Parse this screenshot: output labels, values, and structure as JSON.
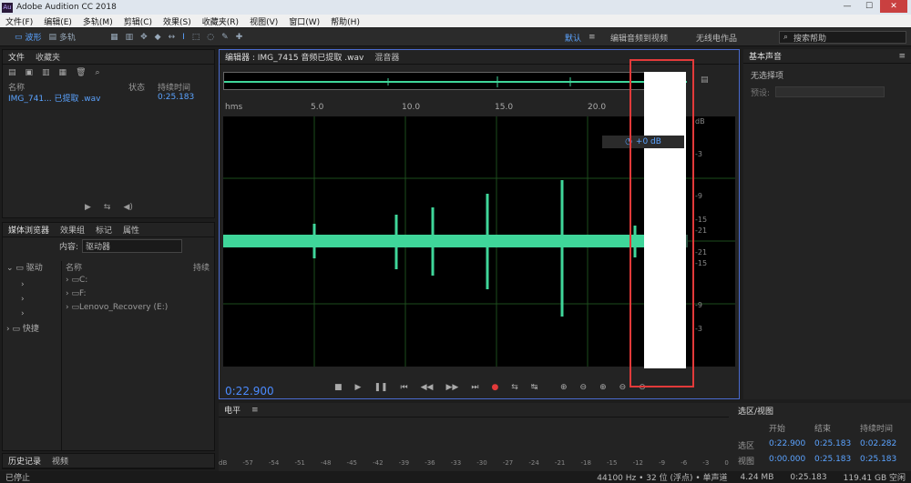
{
  "app": {
    "title": "Adobe Audition CC 2018"
  },
  "menu": [
    "文件(F)",
    "编辑(E)",
    "多轨(M)",
    "剪辑(C)",
    "效果(S)",
    "收藏夹(R)",
    "视图(V)",
    "窗口(W)",
    "帮助(H)"
  ],
  "toolbar": {
    "waveform": "波形",
    "multitrack": "多轨"
  },
  "workspaces": {
    "default": "默认",
    "edit_video": "编辑音频到视频",
    "radio": "无线电作品"
  },
  "search": {
    "label": "搜索帮助"
  },
  "files": {
    "tab1": "文件",
    "tab2": "收藏夹",
    "col_name": "名称",
    "col_status": "状态",
    "col_duration": "持续时间",
    "row_name": "IMG_741... 已提取 .wav",
    "row_duration": "0:25.183"
  },
  "media": {
    "tab1": "媒体浏览器",
    "tab2": "效果组",
    "tab3": "标记",
    "tab4": "属性",
    "content_label": "内容:",
    "content_value": "驱动器",
    "col_name": "名称",
    "col_duration": "持续",
    "tree1": "驱动",
    "tree2": "快捷",
    "items": [
      "C:",
      "F:",
      "Lenovo_Recovery (E:)"
    ]
  },
  "history": {
    "tab1": "历史记录",
    "tab2": "视频"
  },
  "editor": {
    "tab1": "编辑器 : IMG_7415 音频已提取 .wav",
    "tab2": "混音器",
    "timecode": "0:22.900",
    "hms": "hms",
    "ticks": [
      "5.0",
      "10.0",
      "15.0",
      "20.0"
    ],
    "gain": "+0 dB"
  },
  "vscale": [
    "dB",
    "-3",
    "-9",
    "-15",
    "-21",
    "-21",
    "-15",
    "-9",
    "-3"
  ],
  "right": {
    "title": "基本声音",
    "none": "无选择项",
    "preset": "预设:"
  },
  "levels": {
    "title": "电平",
    "scale": [
      "dB",
      "-57",
      "-54",
      "-51",
      "-48",
      "-45",
      "-42",
      "-39",
      "-36",
      "-33",
      "-30",
      "-27",
      "-24",
      "-21",
      "-18",
      "-15",
      "-12",
      "-9",
      "-6",
      "-3",
      "0"
    ]
  },
  "selection": {
    "title": "选区/视图",
    "col_start": "开始",
    "col_end": "结束",
    "col_dur": "持续时间",
    "sel_label": "选区",
    "view_label": "视图",
    "sel_start": "0:22.900",
    "sel_end": "0:25.183",
    "sel_dur": "0:02.282",
    "view_start": "0:00.000",
    "view_end": "0:25.183",
    "view_dur": "0:25.183"
  },
  "status": {
    "left": "已停止",
    "format": "44100 Hz • 32 位 (浮点) • 单声道",
    "size": "4.24 MB",
    "duration": "0:25.183",
    "free": "119.41 GB 空闲"
  },
  "colors": {
    "accent": "#5ba3ff",
    "wave": "#3fd69a",
    "redbox": "#e23a3a"
  }
}
